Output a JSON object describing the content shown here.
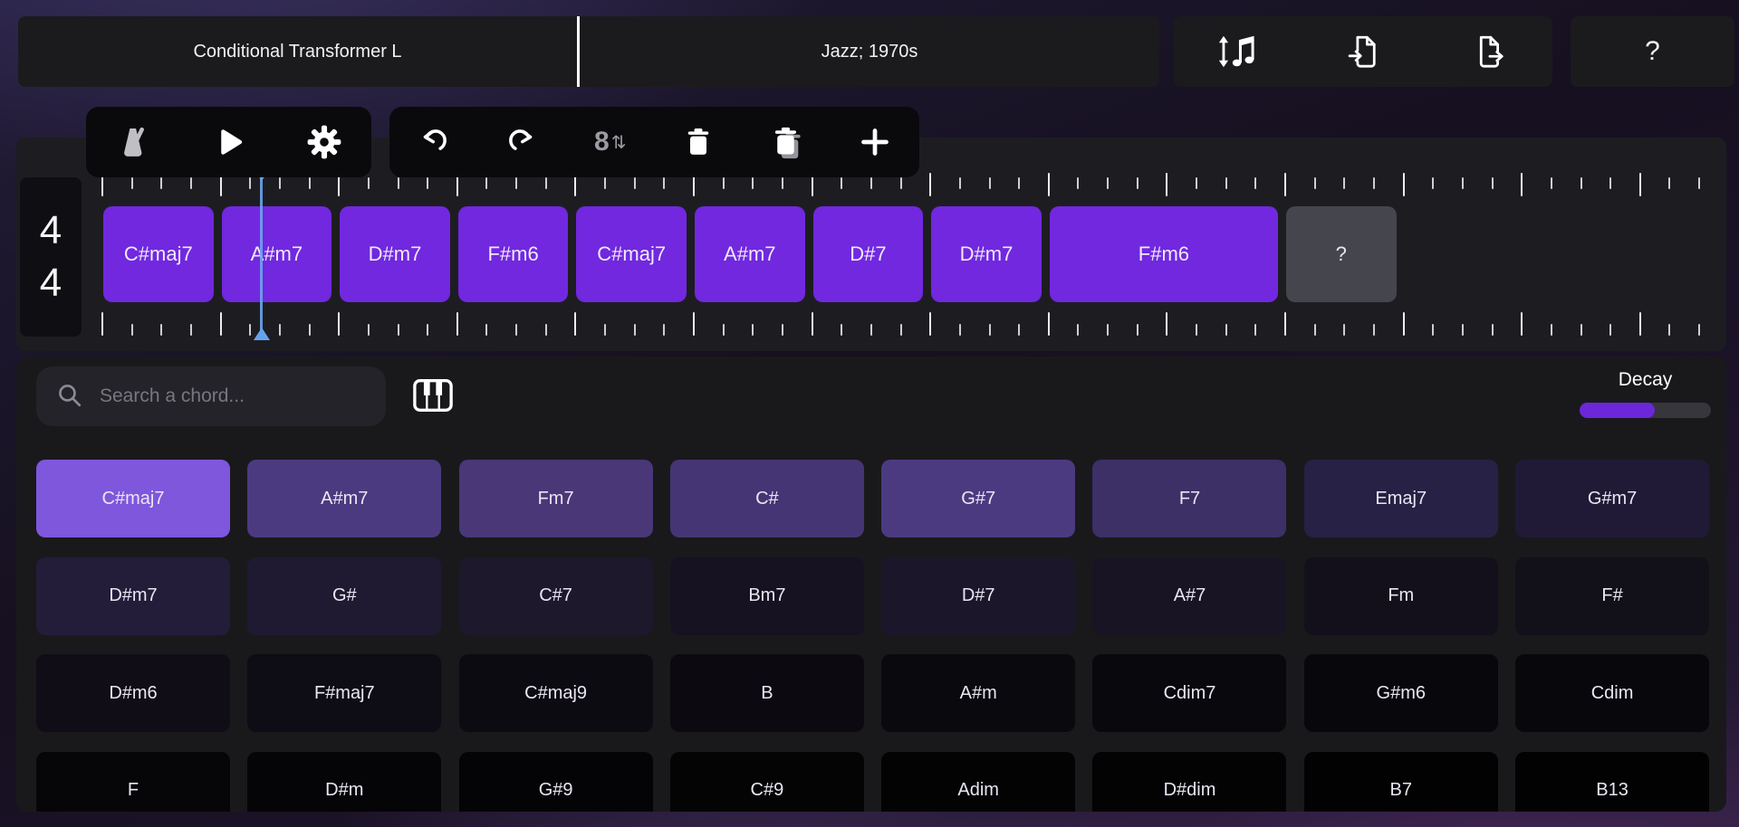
{
  "header": {
    "model_selector": "Conditional Transformer L",
    "style_selector": "Jazz; 1970s",
    "help": "?"
  },
  "icons": {
    "transpose": "music-note-with-vertical-arrows",
    "import": "file-arrow-in",
    "export": "file-arrow-out",
    "metronome": "metronome",
    "play": "play-triangle",
    "settings": "gear",
    "undo": "curved-arrow-left",
    "redo": "curved-arrow-right",
    "octave_digit": "8",
    "octave_arrows": "⇅",
    "delete": "trash",
    "delete_all": "trash-stack",
    "add": "plus",
    "search": "magnifier",
    "piano": "piano-keys"
  },
  "timeline": {
    "time_signature": {
      "numerator": "4",
      "denominator": "4"
    },
    "beats_per_bar": 4,
    "chords": [
      {
        "label": "C#maj7",
        "bars": 1
      },
      {
        "label": "A#m7",
        "bars": 1
      },
      {
        "label": "D#m7",
        "bars": 1
      },
      {
        "label": "F#m6",
        "bars": 1
      },
      {
        "label": "C#maj7",
        "bars": 1
      },
      {
        "label": "A#m7",
        "bars": 1
      },
      {
        "label": "D#7",
        "bars": 1
      },
      {
        "label": "D#m7",
        "bars": 1
      },
      {
        "label": "F#m6",
        "bars": 2
      },
      {
        "label": "?",
        "bars": 1,
        "placeholder": true
      }
    ],
    "playhead": {
      "beats_from_start": 5.42,
      "color": "#66a3ee"
    },
    "chord_color": "#7128df",
    "placeholder_color": "#45454d"
  },
  "suggestions": {
    "search_placeholder": "Search a chord...",
    "decay": {
      "label": "Decay",
      "value_pct": 57,
      "fill_color": "#6b27d9"
    },
    "cards": [
      {
        "label": "C#maj7",
        "bg": "#7e57dd",
        "selected": true
      },
      {
        "label": "A#m7",
        "bg": "#4c3a80"
      },
      {
        "label": "Fm7",
        "bg": "#493777"
      },
      {
        "label": "C#",
        "bg": "#463574"
      },
      {
        "label": "G#7",
        "bg": "#4c3a81"
      },
      {
        "label": "F7",
        "bg": "#3c3067"
      },
      {
        "label": "Emaj7",
        "bg": "#272145"
      },
      {
        "label": "G#m7",
        "bg": "#201a36"
      },
      {
        "label": "D#m7",
        "bg": "#231d39"
      },
      {
        "label": "G#",
        "bg": "#1f1a31"
      },
      {
        "label": "C#7",
        "bg": "#1d182c"
      },
      {
        "label": "Bm7",
        "bg": "#161221"
      },
      {
        "label": "D#7",
        "bg": "#1b1629"
      },
      {
        "label": "A#7",
        "bg": "#181424"
      },
      {
        "label": "Fm",
        "bg": "#13101b"
      },
      {
        "label": "F#",
        "bg": "#121019"
      },
      {
        "label": "D#m6",
        "bg": "#100d17"
      },
      {
        "label": "F#maj7",
        "bg": "#0e0c14"
      },
      {
        "label": "C#maj9",
        "bg": "#0d0b12"
      },
      {
        "label": "B",
        "bg": "#0c0a10"
      },
      {
        "label": "A#m",
        "bg": "#0a090e"
      },
      {
        "label": "Cdim7",
        "bg": "#09080d"
      },
      {
        "label": "G#m6",
        "bg": "#08070c"
      },
      {
        "label": "Cdim",
        "bg": "#08070b"
      },
      {
        "label": "F",
        "bg": "#060508"
      },
      {
        "label": "D#m",
        "bg": "#050407"
      },
      {
        "label": "G#9",
        "bg": "#040406"
      },
      {
        "label": "C#9",
        "bg": "#040405"
      },
      {
        "label": "Adim",
        "bg": "#030304"
      },
      {
        "label": "D#dim",
        "bg": "#030304"
      },
      {
        "label": "B7",
        "bg": "#020203"
      },
      {
        "label": "B13",
        "bg": "#020203"
      }
    ]
  },
  "colors": {
    "accent_purple": "#7128df",
    "selected_card": "#7e57dd",
    "playhead_blue": "#66a3ee",
    "panel_bg": "#19191c",
    "timeline_bg": "#1d1d21",
    "toolbar_bg": "#0a0a0c",
    "topbar_bg": "#1b1b1e"
  }
}
